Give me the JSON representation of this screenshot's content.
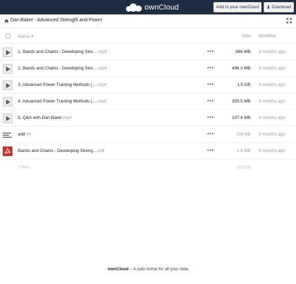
{
  "topbar": {
    "logo_text": "ownCloud",
    "add_button": "Add to your ownCloud",
    "download_button": "Download"
  },
  "breadcrumb": {
    "path": "Dan Baker - Advanced Strength and Power"
  },
  "table": {
    "col_name": "Name",
    "col_size": "Size",
    "col_modified": "Modified",
    "rows": [
      {
        "name": "1. Bands and Chains - Developing Stre…",
        "ext": ".mp4",
        "size": "866 MB",
        "modified": "6 months ago",
        "icon": "video-icon"
      },
      {
        "name": "2. Bands and Chains - Developing Stre…",
        "ext": ".mp4",
        "size": "496.3 MB",
        "modified": "6 months ago",
        "icon": "video-icon"
      },
      {
        "name": "3. Advanced Power Training Methods (…",
        "ext": ".mp4",
        "size": "1.5 GB",
        "modified": "6 months ago",
        "icon": "video-icon"
      },
      {
        "name": "4. Advanced Power Training Methods (…",
        "ext": ".mp4",
        "size": "355.5 MB",
        "modified": "6 months ago",
        "icon": "video-icon"
      },
      {
        "name": "5. Q&A with Dan Baker",
        "ext": ".mp4",
        "size": "107.8 MB",
        "modified": "6 months ago",
        "icon": "video-icon"
      },
      {
        "name": "add",
        "ext": ".txt",
        "size": "206 KB",
        "modified": "6 months ago",
        "icon": "text-file-icon"
      },
      {
        "name": "Bands and Chains - Developing Streng…",
        "ext": ".pdf",
        "size": "1.6 MB",
        "modified": "6 months ago",
        "icon": "pdf-icon"
      }
    ],
    "summary_count": "7 files",
    "summary_total": "3.3 GB"
  },
  "footer": {
    "brand": "ownCloud",
    "tagline": " – A safe home for all your data"
  },
  "colors": {
    "topbar": "#1d2d44",
    "pdf": "#c9302c"
  }
}
